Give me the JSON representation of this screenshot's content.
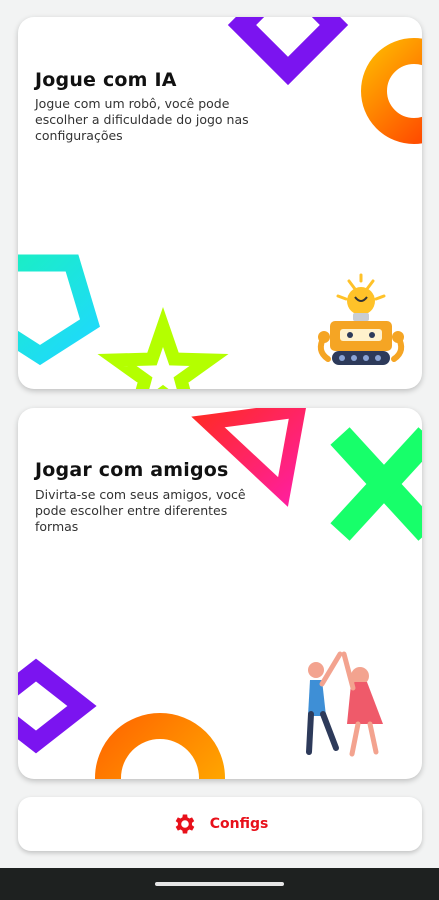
{
  "cards": [
    {
      "id": "ai",
      "title": "Jogue com IA",
      "description": "Jogue com um robô, você pode escolher a dificuldade do jogo nas configurações",
      "illustration": "robot-icon"
    },
    {
      "id": "friends",
      "title": "Jogar com amigos",
      "description": "Divirta-se com seus amigos, você pode escolher entre diferentes formas",
      "illustration": "high-five-icon"
    }
  ],
  "settings_button": {
    "label": "Configs",
    "icon": "gear-icon"
  },
  "colors": {
    "accent": "#e8101a",
    "purple": "#7b14f0",
    "orange": "#ff7a00",
    "cyan": "#19e3d6",
    "lime": "#b4ff00",
    "red": "#ff1f4b",
    "green": "#17ff6a"
  }
}
